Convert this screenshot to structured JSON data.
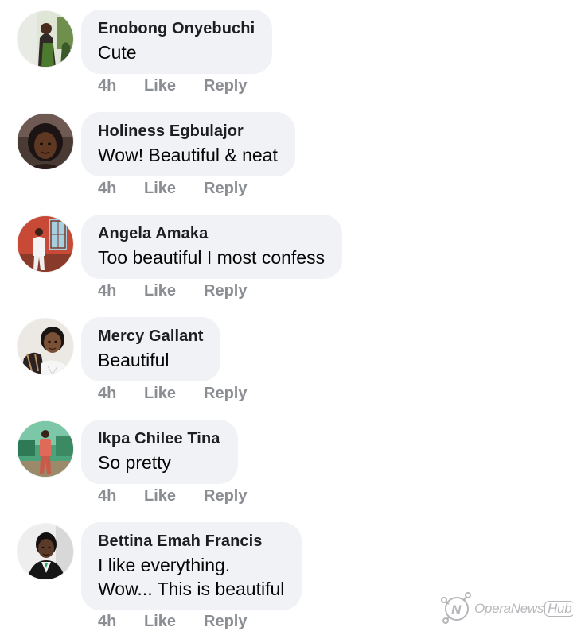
{
  "comments": [
    {
      "author": "Enobong Onyebuchi",
      "lines": [
        "Cute"
      ],
      "time": "4h",
      "like_label": "Like",
      "reply_label": "Reply",
      "avatar_icon": "user-photo-icon",
      "avatar_colors": {
        "bg": "#7a9a5a",
        "accent": "#3b6d2e",
        "figure": "#2a2a2a"
      }
    },
    {
      "author": "Holiness Egbulajor",
      "lines": [
        "Wow! Beautiful & neat"
      ],
      "time": "4h",
      "like_label": "Like",
      "reply_label": "Reply",
      "avatar_icon": "user-photo-icon",
      "avatar_colors": {
        "bg": "#3a2a24",
        "accent": "#1a1010",
        "figure": "#6b4028"
      }
    },
    {
      "author": "Angela Amaka",
      "lines": [
        "Too beautiful I most confess"
      ],
      "time": "4h",
      "like_label": "Like",
      "reply_label": "Reply",
      "avatar_icon": "user-photo-icon",
      "avatar_colors": {
        "bg": "#c9553e",
        "accent": "#8a2e22",
        "figure": "#f2f2f2"
      }
    },
    {
      "author": "Mercy Gallant",
      "lines": [
        "Beautiful"
      ],
      "time": "4h",
      "like_label": "Like",
      "reply_label": "Reply",
      "avatar_icon": "user-photo-icon",
      "avatar_colors": {
        "bg": "#e8e4e0",
        "accent": "#222222",
        "figure": "#6b4a36"
      }
    },
    {
      "author": "Ikpa Chilee Tina",
      "lines": [
        "So pretty"
      ],
      "time": "4h",
      "like_label": "Like",
      "reply_label": "Reply",
      "avatar_icon": "user-photo-icon",
      "avatar_colors": {
        "bg": "#3d8f6a",
        "accent": "#7fc9a8",
        "figure": "#d86a5a"
      }
    },
    {
      "author": "Bettina Emah Francis",
      "lines": [
        "I like everything.",
        "Wow... This is beautiful"
      ],
      "time": "4h",
      "like_label": "Like",
      "reply_label": "Reply",
      "avatar_icon": "user-photo-icon",
      "avatar_colors": {
        "bg": "#e9e9e9",
        "accent": "#1a1a1a",
        "figure": "#5a3a28"
      }
    }
  ],
  "watermark": {
    "brand": "OperaNews",
    "hub": "Hub",
    "icon": "opera-news-logo-icon"
  }
}
